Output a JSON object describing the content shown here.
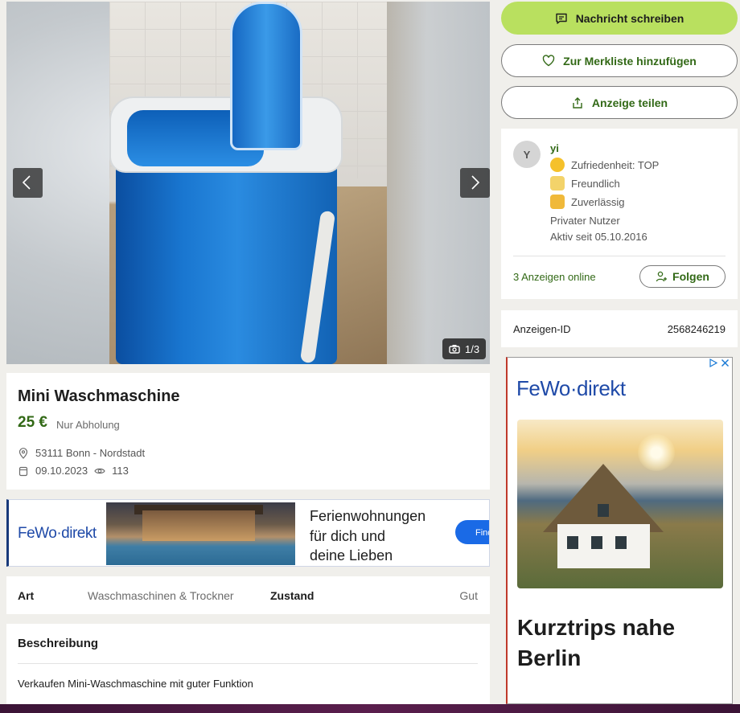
{
  "gallery": {
    "counter": "1/3",
    "prev_icon": "chevron-left-icon",
    "next_icon": "chevron-right-icon",
    "camera_icon": "camera-icon"
  },
  "listing": {
    "title": "Mini Waschmaschine",
    "price": "25 €",
    "shipping": "Nur Abholung",
    "location": "53111 Bonn - Nordstadt",
    "date": "09.10.2023",
    "views": "113"
  },
  "banner_ad": {
    "brand": "FeWo·direkt",
    "headline_lines": [
      "Ferienwohnungen",
      "für dich und",
      "deine Lieben"
    ],
    "cta": "Find"
  },
  "attributes": [
    {
      "key": "Art",
      "value": "Waschmaschinen & Trockner"
    },
    {
      "key": "Zustand",
      "value": "Gut"
    }
  ],
  "description": {
    "heading": "Beschreibung",
    "text": "Verkaufen Mini-Waschmaschine mit guter Funktion"
  },
  "actions": {
    "message": "Nachricht schreiben",
    "watchlist": "Zur Merkliste hinzufügen",
    "share": "Anzeige teilen"
  },
  "seller": {
    "initial": "Y",
    "name": "yi",
    "badges": [
      "Zufriedenheit: TOP",
      "Freundlich",
      "Zuverlässig"
    ],
    "type": "Privater Nutzer",
    "active_since": "Aktiv seit 05.10.2016",
    "ads_online": "3 Anzeigen online",
    "follow": "Folgen"
  },
  "ad_id": {
    "label": "Anzeigen-ID",
    "value": "2568246219"
  },
  "sky_ad": {
    "brand": "FeWo·direkt",
    "headline_lines": [
      "Kurztrips nahe",
      "Berlin"
    ]
  },
  "colors": {
    "brand_green": "#326916",
    "primary_button": "#b9e05f",
    "ad_blue": "#1f4aa8"
  }
}
